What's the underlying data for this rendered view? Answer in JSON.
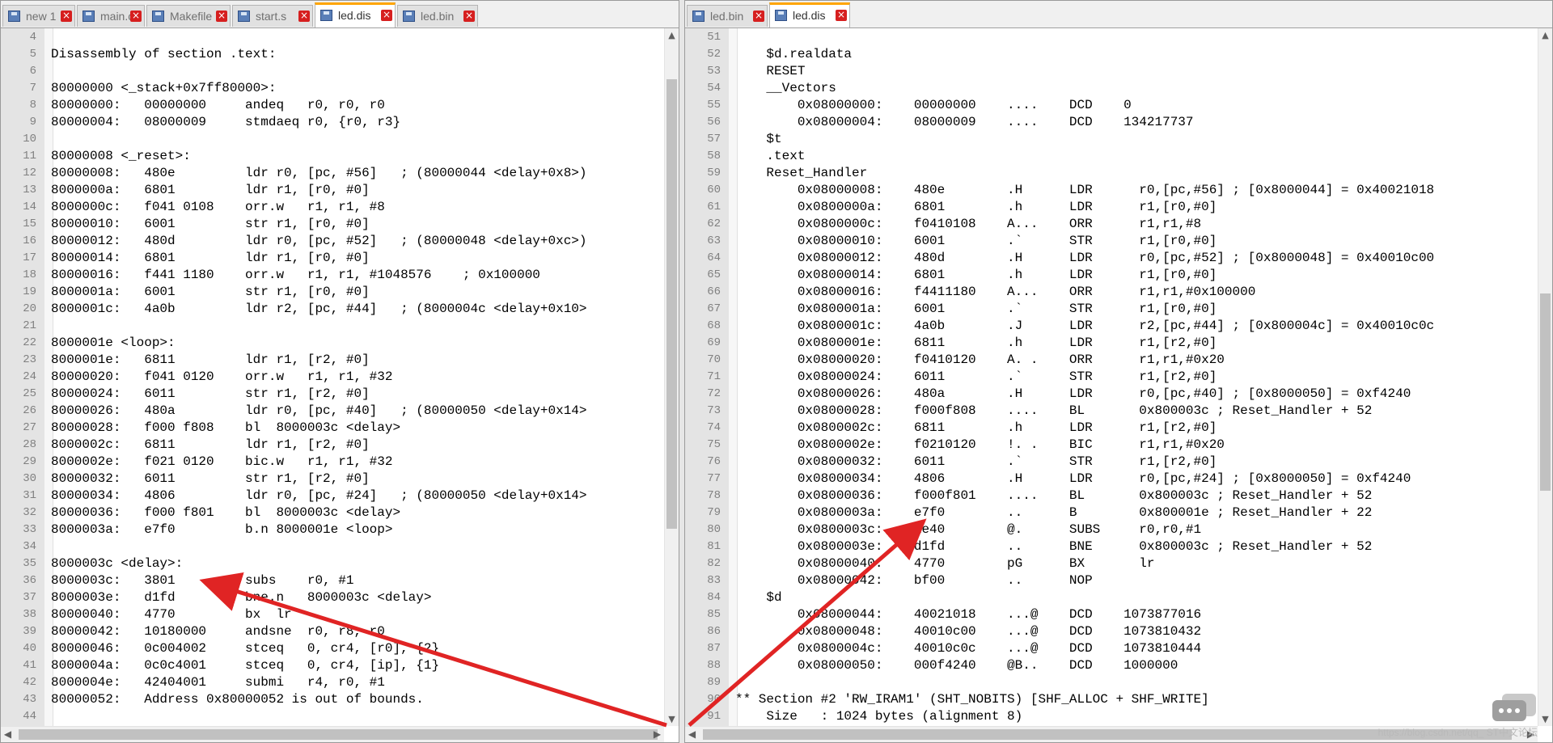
{
  "left_pane": {
    "tabs": [
      {
        "label": "new 1",
        "active": false
      },
      {
        "label": "main.c",
        "active": false
      },
      {
        "label": "Makefile",
        "active": false
      },
      {
        "label": "start.s",
        "active": false
      },
      {
        "label": "led.dis",
        "active": true
      },
      {
        "label": "led.bin",
        "active": false
      }
    ],
    "lines": [
      {
        "n": "4",
        "t": ""
      },
      {
        "n": "5",
        "t": "Disassembly of section .text:"
      },
      {
        "n": "6",
        "t": ""
      },
      {
        "n": "7",
        "t": "80000000 <_stack+0x7ff80000>:"
      },
      {
        "n": "8",
        "t": "80000000:   00000000     andeq   r0, r0, r0"
      },
      {
        "n": "9",
        "t": "80000004:   08000009     stmdaeq r0, {r0, r3}"
      },
      {
        "n": "10",
        "t": ""
      },
      {
        "n": "11",
        "t": "80000008 <_reset>:"
      },
      {
        "n": "12",
        "t": "80000008:   480e         ldr r0, [pc, #56]   ; (80000044 <delay+0x8>)"
      },
      {
        "n": "13",
        "t": "8000000a:   6801         ldr r1, [r0, #0]"
      },
      {
        "n": "14",
        "t": "8000000c:   f041 0108    orr.w   r1, r1, #8"
      },
      {
        "n": "15",
        "t": "80000010:   6001         str r1, [r0, #0]"
      },
      {
        "n": "16",
        "t": "80000012:   480d         ldr r0, [pc, #52]   ; (80000048 <delay+0xc>)"
      },
      {
        "n": "17",
        "t": "80000014:   6801         ldr r1, [r0, #0]"
      },
      {
        "n": "18",
        "t": "80000016:   f441 1180    orr.w   r1, r1, #1048576    ; 0x100000"
      },
      {
        "n": "19",
        "t": "8000001a:   6001         str r1, [r0, #0]"
      },
      {
        "n": "20",
        "t": "8000001c:   4a0b         ldr r2, [pc, #44]   ; (8000004c <delay+0x10>"
      },
      {
        "n": "21",
        "t": ""
      },
      {
        "n": "22",
        "t": "8000001e <loop>:"
      },
      {
        "n": "23",
        "t": "8000001e:   6811         ldr r1, [r2, #0]"
      },
      {
        "n": "24",
        "t": "80000020:   f041 0120    orr.w   r1, r1, #32"
      },
      {
        "n": "25",
        "t": "80000024:   6011         str r1, [r2, #0]"
      },
      {
        "n": "26",
        "t": "80000026:   480a         ldr r0, [pc, #40]   ; (80000050 <delay+0x14>"
      },
      {
        "n": "27",
        "t": "80000028:   f000 f808    bl  8000003c <delay>"
      },
      {
        "n": "28",
        "t": "8000002c:   6811         ldr r1, [r2, #0]"
      },
      {
        "n": "29",
        "t": "8000002e:   f021 0120    bic.w   r1, r1, #32"
      },
      {
        "n": "30",
        "t": "80000032:   6011         str r1, [r2, #0]"
      },
      {
        "n": "31",
        "t": "80000034:   4806         ldr r0, [pc, #24]   ; (80000050 <delay+0x14>"
      },
      {
        "n": "32",
        "t": "80000036:   f000 f801    bl  8000003c <delay>"
      },
      {
        "n": "33",
        "t": "8000003a:   e7f0         b.n 8000001e <loop>"
      },
      {
        "n": "34",
        "t": ""
      },
      {
        "n": "35",
        "t": "8000003c <delay>:"
      },
      {
        "n": "36",
        "t": "8000003c:   3801         subs    r0, #1"
      },
      {
        "n": "37",
        "t": "8000003e:   d1fd         bne.n   8000003c <delay>"
      },
      {
        "n": "38",
        "t": "80000040:   4770         bx  lr"
      },
      {
        "n": "39",
        "t": "80000042:   10180000     andsne  r0, r8, r0"
      },
      {
        "n": "40",
        "t": "80000046:   0c004002     stceq   0, cr4, [r0], {2}"
      },
      {
        "n": "41",
        "t": "8000004a:   0c0c4001     stceq   0, cr4, [ip], {1}"
      },
      {
        "n": "42",
        "t": "8000004e:   42404001     submi   r4, r0, #1"
      },
      {
        "n": "43",
        "t": "80000052:   Address 0x80000052 is out of bounds."
      },
      {
        "n": "44",
        "t": ""
      }
    ]
  },
  "right_pane": {
    "tabs": [
      {
        "label": "led.bin",
        "active": false
      },
      {
        "label": "led.dis",
        "active": true
      }
    ],
    "lines": [
      {
        "n": "51",
        "t": ""
      },
      {
        "n": "52",
        "t": "    $d.realdata"
      },
      {
        "n": "53",
        "t": "    RESET"
      },
      {
        "n": "54",
        "t": "    __Vectors"
      },
      {
        "n": "55",
        "t": "        0x08000000:    00000000    ....    DCD    0"
      },
      {
        "n": "56",
        "t": "        0x08000004:    08000009    ....    DCD    134217737"
      },
      {
        "n": "57",
        "t": "    $t"
      },
      {
        "n": "58",
        "t": "    .text"
      },
      {
        "n": "59",
        "t": "    Reset_Handler"
      },
      {
        "n": "60",
        "t": "        0x08000008:    480e        .H      LDR      r0,[pc,#56] ; [0x8000044] = 0x40021018"
      },
      {
        "n": "61",
        "t": "        0x0800000a:    6801        .h      LDR      r1,[r0,#0]"
      },
      {
        "n": "62",
        "t": "        0x0800000c:    f0410108    A...    ORR      r1,r1,#8"
      },
      {
        "n": "63",
        "t": "        0x08000010:    6001        .`      STR      r1,[r0,#0]"
      },
      {
        "n": "64",
        "t": "        0x08000012:    480d        .H      LDR      r0,[pc,#52] ; [0x8000048] = 0x40010c00"
      },
      {
        "n": "65",
        "t": "        0x08000014:    6801        .h      LDR      r1,[r0,#0]"
      },
      {
        "n": "66",
        "t": "        0x08000016:    f4411180    A...    ORR      r1,r1,#0x100000"
      },
      {
        "n": "67",
        "t": "        0x0800001a:    6001        .`      STR      r1,[r0,#0]"
      },
      {
        "n": "68",
        "t": "        0x0800001c:    4a0b        .J      LDR      r2,[pc,#44] ; [0x800004c] = 0x40010c0c"
      },
      {
        "n": "69",
        "t": "        0x0800001e:    6811        .h      LDR      r1,[r2,#0]"
      },
      {
        "n": "70",
        "t": "        0x08000020:    f0410120    A. .    ORR      r1,r1,#0x20"
      },
      {
        "n": "71",
        "t": "        0x08000024:    6011        .`      STR      r1,[r2,#0]"
      },
      {
        "n": "72",
        "t": "        0x08000026:    480a        .H      LDR      r0,[pc,#40] ; [0x8000050] = 0xf4240"
      },
      {
        "n": "73",
        "t": "        0x08000028:    f000f808    ....    BL       0x800003c ; Reset_Handler + 52"
      },
      {
        "n": "74",
        "t": "        0x0800002c:    6811        .h      LDR      r1,[r2,#0]"
      },
      {
        "n": "75",
        "t": "        0x0800002e:    f0210120    !. .    BIC      r1,r1,#0x20"
      },
      {
        "n": "76",
        "t": "        0x08000032:    6011        .`      STR      r1,[r2,#0]"
      },
      {
        "n": "77",
        "t": "        0x08000034:    4806        .H      LDR      r0,[pc,#24] ; [0x8000050] = 0xf4240"
      },
      {
        "n": "78",
        "t": "        0x08000036:    f000f801    ....    BL       0x800003c ; Reset_Handler + 52"
      },
      {
        "n": "79",
        "t": "        0x0800003a:    e7f0        ..      B        0x800001e ; Reset_Handler + 22"
      },
      {
        "n": "80",
        "t": "        0x0800003c:    1e40        @.      SUBS     r0,r0,#1"
      },
      {
        "n": "81",
        "t": "        0x0800003e:    d1fd        ..      BNE      0x800003c ; Reset_Handler + 52"
      },
      {
        "n": "82",
        "t": "        0x08000040:    4770        pG      BX       lr"
      },
      {
        "n": "83",
        "t": "        0x08000042:    bf00        ..      NOP"
      },
      {
        "n": "84",
        "t": "    $d"
      },
      {
        "n": "85",
        "t": "        0x08000044:    40021018    ...@    DCD    1073877016"
      },
      {
        "n": "86",
        "t": "        0x08000048:    40010c00    ...@    DCD    1073810432"
      },
      {
        "n": "87",
        "t": "        0x0800004c:    40010c0c    ...@    DCD    1073810444"
      },
      {
        "n": "88",
        "t": "        0x08000050:    000f4240    @B..    DCD    1000000"
      },
      {
        "n": "89",
        "t": ""
      },
      {
        "n": "90",
        "t": "** Section #2 'RW_IRAM1' (SHT_NOBITS) [SHF_ALLOC + SHF_WRITE]"
      },
      {
        "n": "91",
        "t": "    Size   : 1024 bytes (alignment 8)"
      }
    ]
  },
  "watermark": {
    "text": "https://blog.csdn.net/qq_ ST中文论坛"
  },
  "colors": {
    "annotation_arrow": "#e02424",
    "active_tab_accent": "#ffa500",
    "tab_close": "#d61f1f",
    "gutter": "#e4e4e4"
  },
  "icons": [
    "file-icon",
    "close-icon",
    "scroll-up-icon",
    "scroll-down-icon",
    "scroll-left-icon",
    "scroll-right-icon",
    "chat-bubble-icon"
  ]
}
